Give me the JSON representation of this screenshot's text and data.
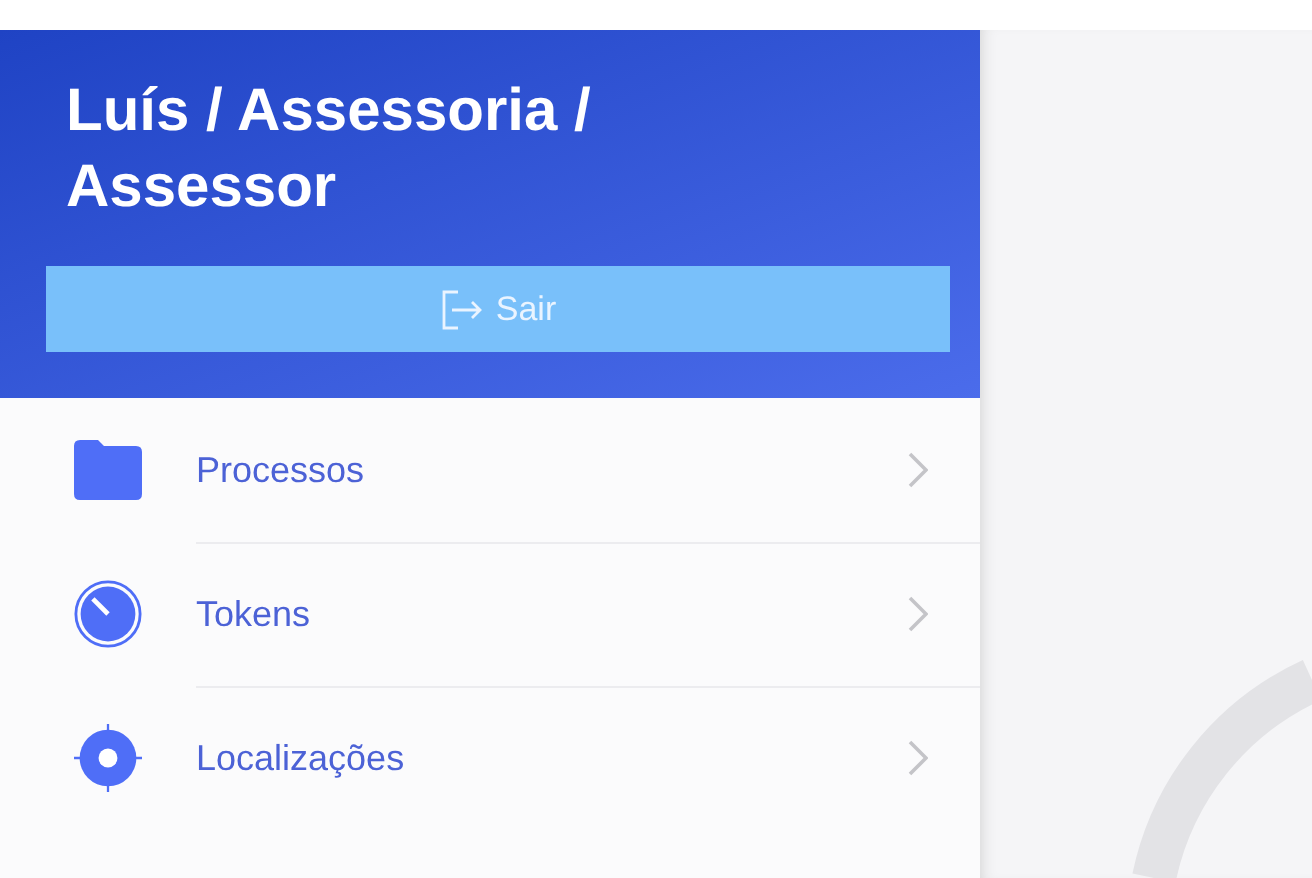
{
  "header": {
    "title": "Luís / Assessoria / Assessor",
    "logout_button": "Sair"
  },
  "menu": [
    {
      "label": "Processos",
      "kind": "folder"
    },
    {
      "label": "Tokens",
      "kind": "timer"
    },
    {
      "label": "Localizações",
      "kind": "location"
    }
  ]
}
